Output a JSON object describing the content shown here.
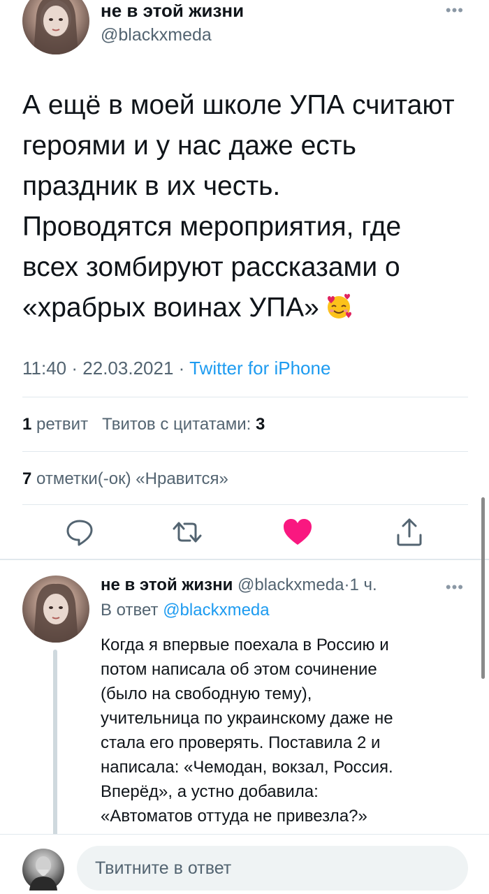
{
  "main_tweet": {
    "author_name": "не в этой жизни",
    "author_handle": "@blackxmeda",
    "text_lines": [
      "А ещё в моей школе УПА считают",
      "героями и у нас даже есть",
      "праздник в их честь.",
      "Проводятся мероприятия, где",
      "всех зомбируют рассказами о",
      "«храбрых воинах УПА»"
    ],
    "emoji": "smiling-face-with-hearts",
    "time": "11:40",
    "date": "22.03.2021",
    "separator": "·",
    "source": "Twitter for iPhone",
    "retweets_count": "1",
    "retweets_label": "ретвит",
    "quotes_label": "Твитов с цитатами:",
    "quotes_count": "3",
    "likes_count": "7",
    "likes_label": "отметки(-ок) «Нравится»",
    "liked": true
  },
  "actions": {
    "reply_icon": "reply-icon",
    "retweet_icon": "retweet-icon",
    "like_icon": "heart-icon",
    "share_icon": "share-icon"
  },
  "reply_tweet": {
    "author_name": "не в этой жизни",
    "author_handle": "@blackxmeda",
    "separator": "·",
    "time_ago": "1 ч.",
    "reply_prefix": "В ответ",
    "reply_to_handle": "@blackxmeda",
    "text_lines": [
      "Когда я впервые поехала в Россию и",
      "потом написала об этом сочинение",
      "(было на свободную тему),",
      "учительница по украинскому даже не",
      "стала его проверять. Поставила 2 и",
      "написала: «Чемодан, вокзал, Россия.",
      "Вперёд», а устно добавила:",
      "«Автоматов оттуда не привезла?»"
    ]
  },
  "compose": {
    "placeholder": "Твитните в ответ"
  },
  "colors": {
    "accent": "#1d9bf0",
    "like": "#f91880",
    "secondary_text": "#536471",
    "icon": "#536471"
  }
}
